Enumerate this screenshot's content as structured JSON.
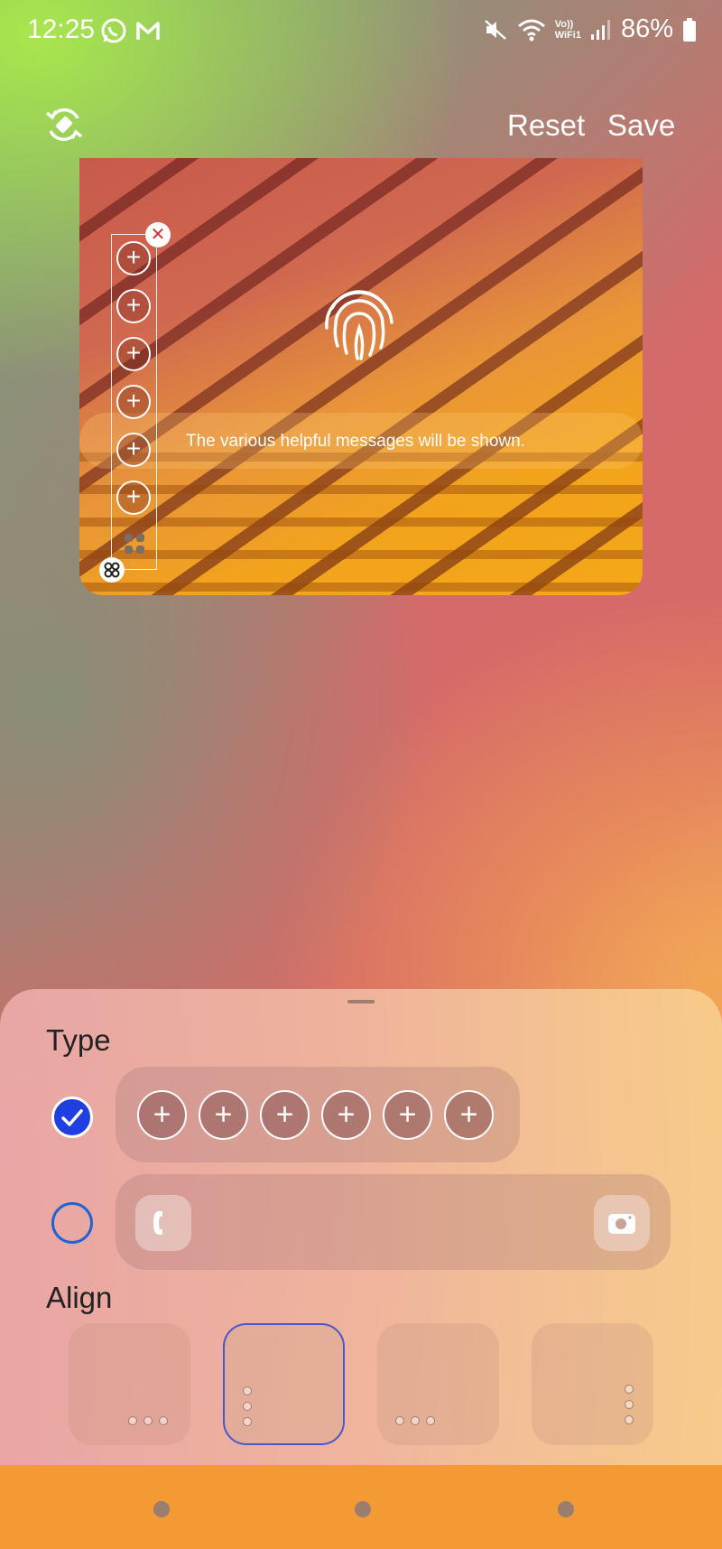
{
  "status_bar": {
    "time": "12:25",
    "battery": "86%",
    "network_label_top": "Vo))",
    "network_label_bottom": "WiFi1"
  },
  "toolbar": {
    "reset_label": "Reset",
    "save_label": "Save"
  },
  "preview": {
    "message": "The various helpful messages will be shown."
  },
  "sheet": {
    "type_label": "Type",
    "align_label": "Align"
  },
  "colors": {
    "accent_blue": "#1f3fe0",
    "nav_bar": "#f49a35"
  }
}
